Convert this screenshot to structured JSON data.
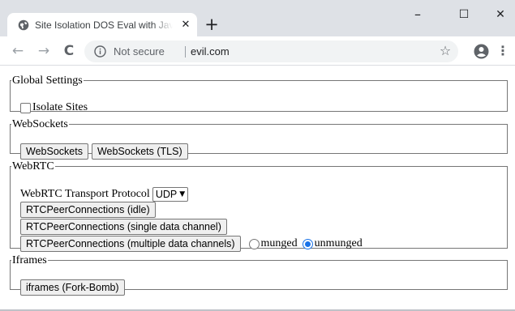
{
  "browser": {
    "tab_title": "Site Isolation DOS Eval with JavaScript",
    "tab_close": "✕",
    "new_tab": "+",
    "window": {
      "minimize": "–",
      "maximize": "☐",
      "close": "✕"
    },
    "nav": {
      "back": "←",
      "forward": "→",
      "reload": "C"
    },
    "omnibox": {
      "security": "Not secure",
      "url": "evil.com"
    },
    "bookmark_icon": "☆",
    "menu_icon": "⋮",
    "icons": [
      "globe-icon",
      "info-icon",
      "star-icon",
      "profile-icon",
      "menu-icon"
    ],
    "colors": {
      "titlebar": "#dee1e6",
      "omnibox": "#f1f3f4",
      "radio_accent": "#1a73e8"
    }
  },
  "page": {
    "global": {
      "legend": "Global Settings",
      "isolate_label": "Isolate Sites",
      "isolate_checked": false
    },
    "websockets": {
      "legend": "WebSockets",
      "buttons": [
        "WebSockets",
        "WebSockets (TLS)"
      ]
    },
    "webrtc": {
      "legend": "WebRTC",
      "protocol_label": "WebRTC Transport Protocol",
      "protocol_value": "UDP",
      "buttons": [
        "RTCPeerConnections (idle)",
        "RTCPeerConnections (single data channel)",
        "RTCPeerConnections (multiple data channels)"
      ],
      "radio_munged": "munged",
      "radio_unmunged": "unmunged",
      "selected": "unmunged"
    },
    "iframes": {
      "legend": "Iframes",
      "buttons": [
        "iframes (Fork-Bomb)"
      ]
    }
  }
}
